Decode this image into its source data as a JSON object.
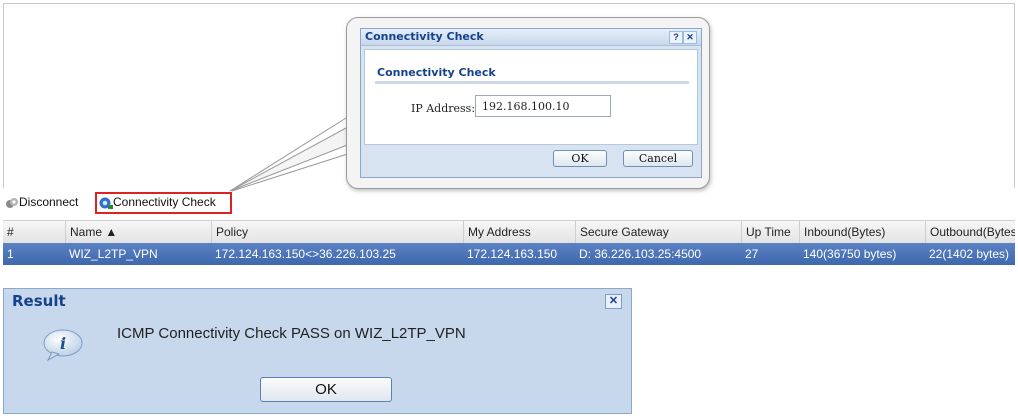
{
  "connectivity_dialog": {
    "title": "Connectivity Check",
    "help_button": "?",
    "close_button": "✕",
    "section_title": "Connectivity Check",
    "ip_label": "IP Address:",
    "ip_value": "192.168.100.10",
    "ok_label": "OK",
    "cancel_label": "Cancel"
  },
  "toolbar": {
    "disconnect_label": "Disconnect",
    "connectivity_label": "Connectivity Check",
    "highlight_color": "#dd2222"
  },
  "table": {
    "columns": [
      "#",
      "Name ▲",
      "Policy",
      "My Address",
      "Secure Gateway",
      "Up Time",
      "Inbound(Bytes)",
      "Outbound(Bytes"
    ],
    "rows": [
      [
        "1",
        "WIZ_L2TP_VPN",
        "172.124.163.150<>36.226.103.25",
        "172.124.163.150",
        "D: 36.226.103.25:4500",
        "27",
        "140(36750 bytes)",
        "22(1402 bytes)"
      ]
    ],
    "selected_row_color": "#4a72b6"
  },
  "result_dialog": {
    "title": "Result",
    "close_button": "✕",
    "message": "ICMP Connectivity Check PASS on WIZ_L2TP_VPN",
    "icon": "info-icon",
    "ok_label": "OK"
  }
}
